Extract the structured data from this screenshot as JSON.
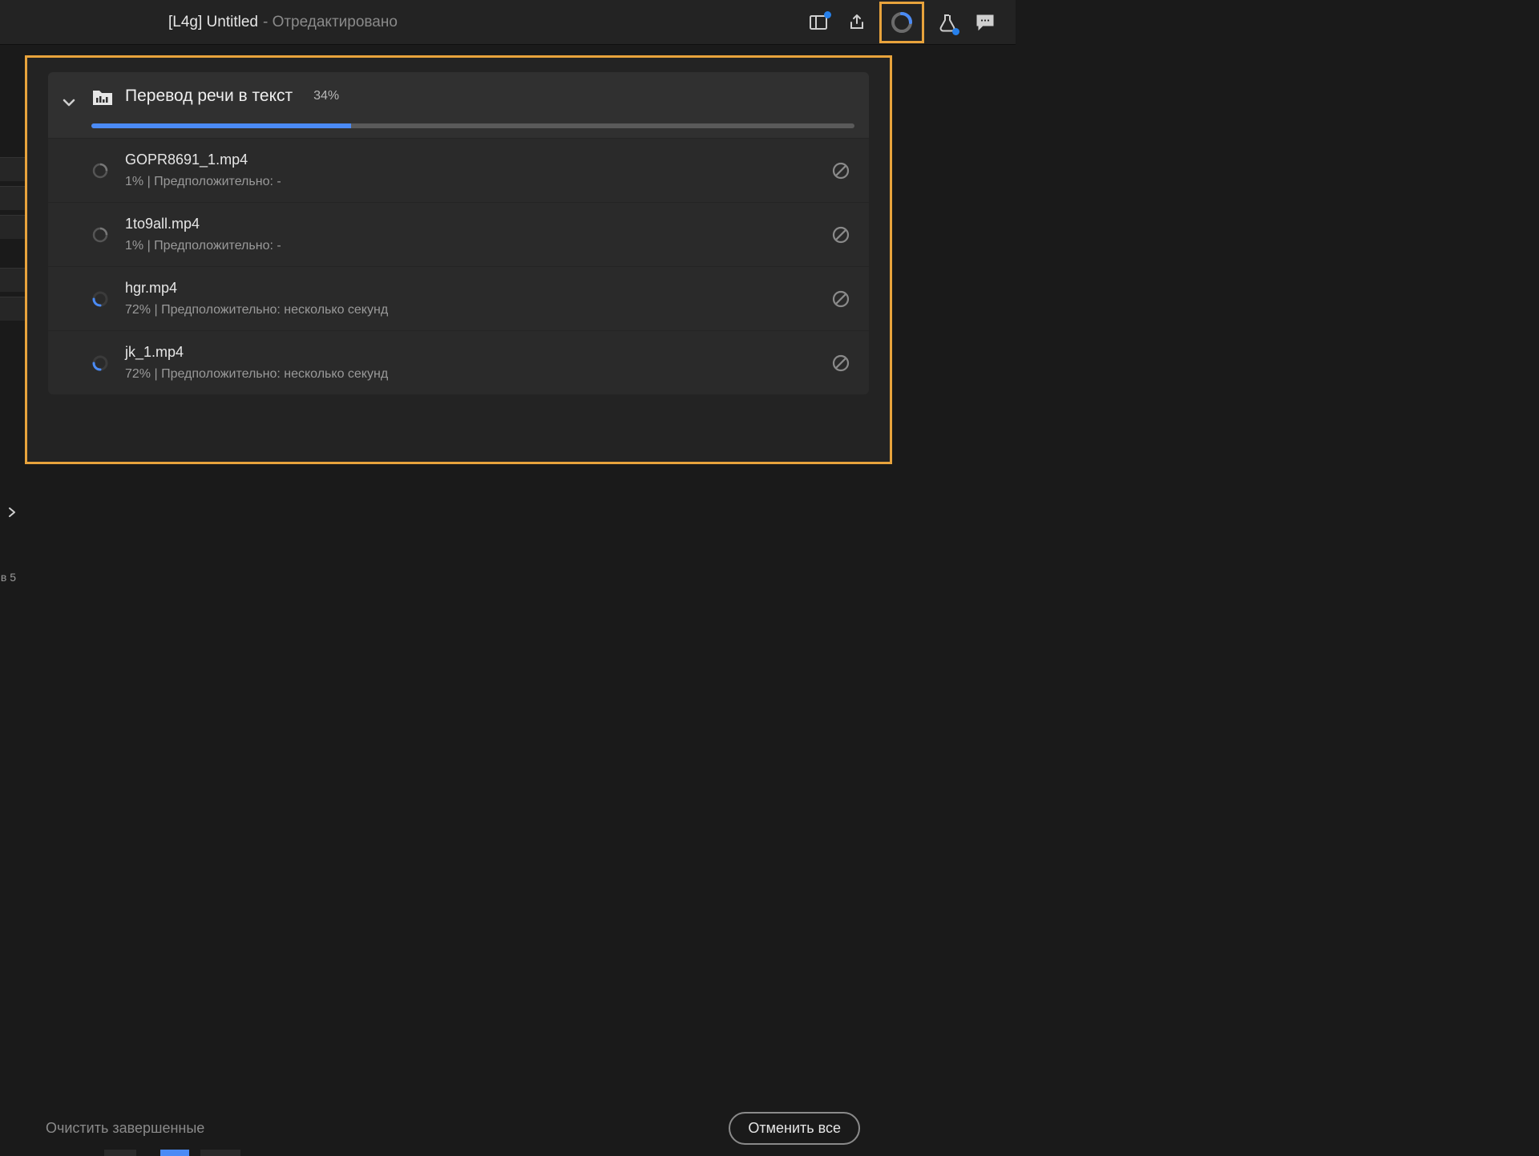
{
  "header": {
    "title": "[L4g] Untitled",
    "suffix": "- Отредактировано"
  },
  "task": {
    "title": "Перевод речи в текст",
    "percent_label": "34%",
    "percent_value": 34
  },
  "items": [
    {
      "name": "GOPR8691_1.mp4",
      "sub": "1% | Предположительно: -",
      "spinner": "idle"
    },
    {
      "name": "1to9all.mp4",
      "sub": "1% | Предположительно: -",
      "spinner": "idle"
    },
    {
      "name": "hgr.mp4",
      "sub": "72% | Предположительно: несколько секунд",
      "spinner": "active"
    },
    {
      "name": "jk_1.mp4",
      "sub": "72% | Предположительно: несколько секунд",
      "spinner": "active"
    }
  ],
  "footer": {
    "clear": "Очистить завершенные",
    "cancel_all": "Отменить все"
  },
  "left": {
    "label": "в 5"
  }
}
